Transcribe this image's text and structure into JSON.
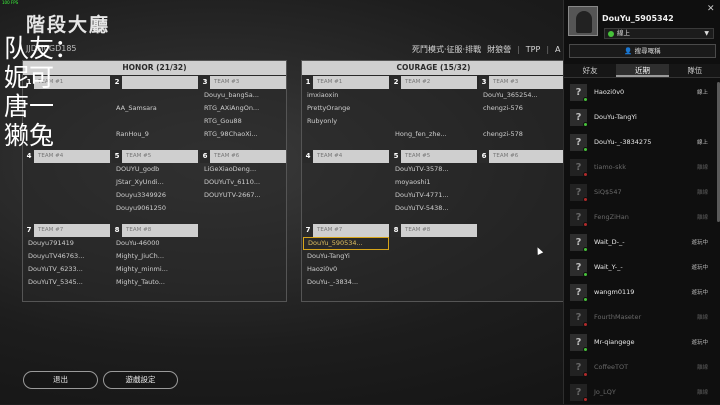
{
  "fps": "100 FPS",
  "title": "階段大廳",
  "lobby_id": "JJDM0GD185",
  "overlay_lines": [
    "队友：",
    "妮可",
    "唐一",
    "獭兔"
  ],
  "mode_bar": [
    "死鬥模式·征服·排戰",
    "財狼營",
    "TPP",
    "A"
  ],
  "teams": [
    {
      "header": "HONOR (21/32)",
      "squads": [
        {
          "num": "1",
          "label": "TEAM #1",
          "players": [
            "",
            "",
            "",
            ""
          ]
        },
        {
          "num": "2",
          "label": "",
          "players": [
            "",
            "AA_Samsara",
            "",
            "RanHou_9"
          ]
        },
        {
          "num": "3",
          "label": "TEAM #3",
          "players": [
            "Douyu_bangSa...",
            "RTG_AXiAngOn...",
            "RTG_Gou88",
            "RTG_98ChaoXi..."
          ]
        },
        {
          "num": "4",
          "label": "TEAM #4",
          "players": [
            "",
            "",
            "",
            ""
          ]
        },
        {
          "num": "5",
          "label": "TEAM #5",
          "players": [
            "DOUYU_godb",
            "JStar_XyUndi...",
            "Douyu3349926",
            "Douyu9061250"
          ]
        },
        {
          "num": "6",
          "label": "TEAM #6",
          "players": [
            "LiGeXiaoDeng...",
            "DOUYuTv_6110...",
            "DOUYUTV-2667...",
            ""
          ]
        },
        {
          "num": "7",
          "label": "TEAM #7",
          "players": [
            "Douyu791419",
            "DouyuTV46763...",
            "DouYuTV_6233...",
            "DouYuTV_5345..."
          ]
        },
        {
          "num": "8",
          "label": "TEAM #8",
          "players": [
            "DouYu-46000",
            "Mighty_JiuCh...",
            "Mighty_minmi...",
            "Mighty_Tauto..."
          ]
        }
      ]
    },
    {
      "header": "COURAGE (15/32)",
      "squads": [
        {
          "num": "1",
          "label": "TEAM #1",
          "players": [
            "imxiaoxin",
            "PrettyOrange",
            "Rubyonly",
            ""
          ]
        },
        {
          "num": "2",
          "label": "TEAM #2",
          "players": [
            "",
            "",
            "",
            "Hong_fen_zhe..."
          ]
        },
        {
          "num": "3",
          "label": "TEAM #3",
          "players": [
            "DouYu_365254...",
            "chengzi-576",
            "",
            "chengzi-578"
          ]
        },
        {
          "num": "4",
          "label": "TEAM #4",
          "players": [
            "",
            "",
            "",
            ""
          ]
        },
        {
          "num": "5",
          "label": "TEAM #5",
          "players": [
            "DouYuTV-3578...",
            "moyaoshi1",
            "DouYuTV-4771...",
            "DouYuTV-5438..."
          ]
        },
        {
          "num": "6",
          "label": "TEAM #6",
          "players": [
            "",
            "",
            "",
            ""
          ]
        },
        {
          "num": "7",
          "label": "TEAM #7",
          "players": [
            "DouYu_590534...",
            "DouYu-TangYi",
            "Haozi0v0",
            "DouYu-_-3834..."
          ]
        },
        {
          "num": "8",
          "label": "TEAM #8",
          "players": [
            "",
            "",
            "",
            ""
          ]
        }
      ]
    }
  ],
  "buttons": {
    "exit": "退出",
    "settings": "遊戲設定"
  },
  "panel": {
    "me_name": "DouYu_5905342",
    "status": "線上",
    "search_label": "搜尋嘅稱",
    "tabs": [
      "好友",
      "近期",
      "隊伍"
    ],
    "friends": [
      {
        "name": "Haozi0v0",
        "status": "線上",
        "online": true
      },
      {
        "name": "DouYu-TangYi",
        "status": "",
        "online": true
      },
      {
        "name": "DouYu-_-3834275",
        "status": "線上",
        "online": true
      },
      {
        "name": "tiamo-skk",
        "status": "離線",
        "online": false
      },
      {
        "name": "SiQ$547",
        "status": "離線",
        "online": false
      },
      {
        "name": "FengZiHan",
        "status": "離線",
        "online": false
      },
      {
        "name": "Wait_D-_-",
        "status": "遊玩中",
        "online": true
      },
      {
        "name": "Wait_Y-_-",
        "status": "遊玩中",
        "online": true
      },
      {
        "name": "wangm0119",
        "status": "遊玩中",
        "online": true
      },
      {
        "name": "FourthMaseter",
        "status": "離線",
        "online": false
      },
      {
        "name": "Mr-qiangege",
        "status": "遊玩中",
        "online": true
      },
      {
        "name": "CoffeeTOT",
        "status": "離線",
        "online": false
      },
      {
        "name": "Jo_LQY",
        "status": "離線",
        "online": false
      }
    ]
  }
}
